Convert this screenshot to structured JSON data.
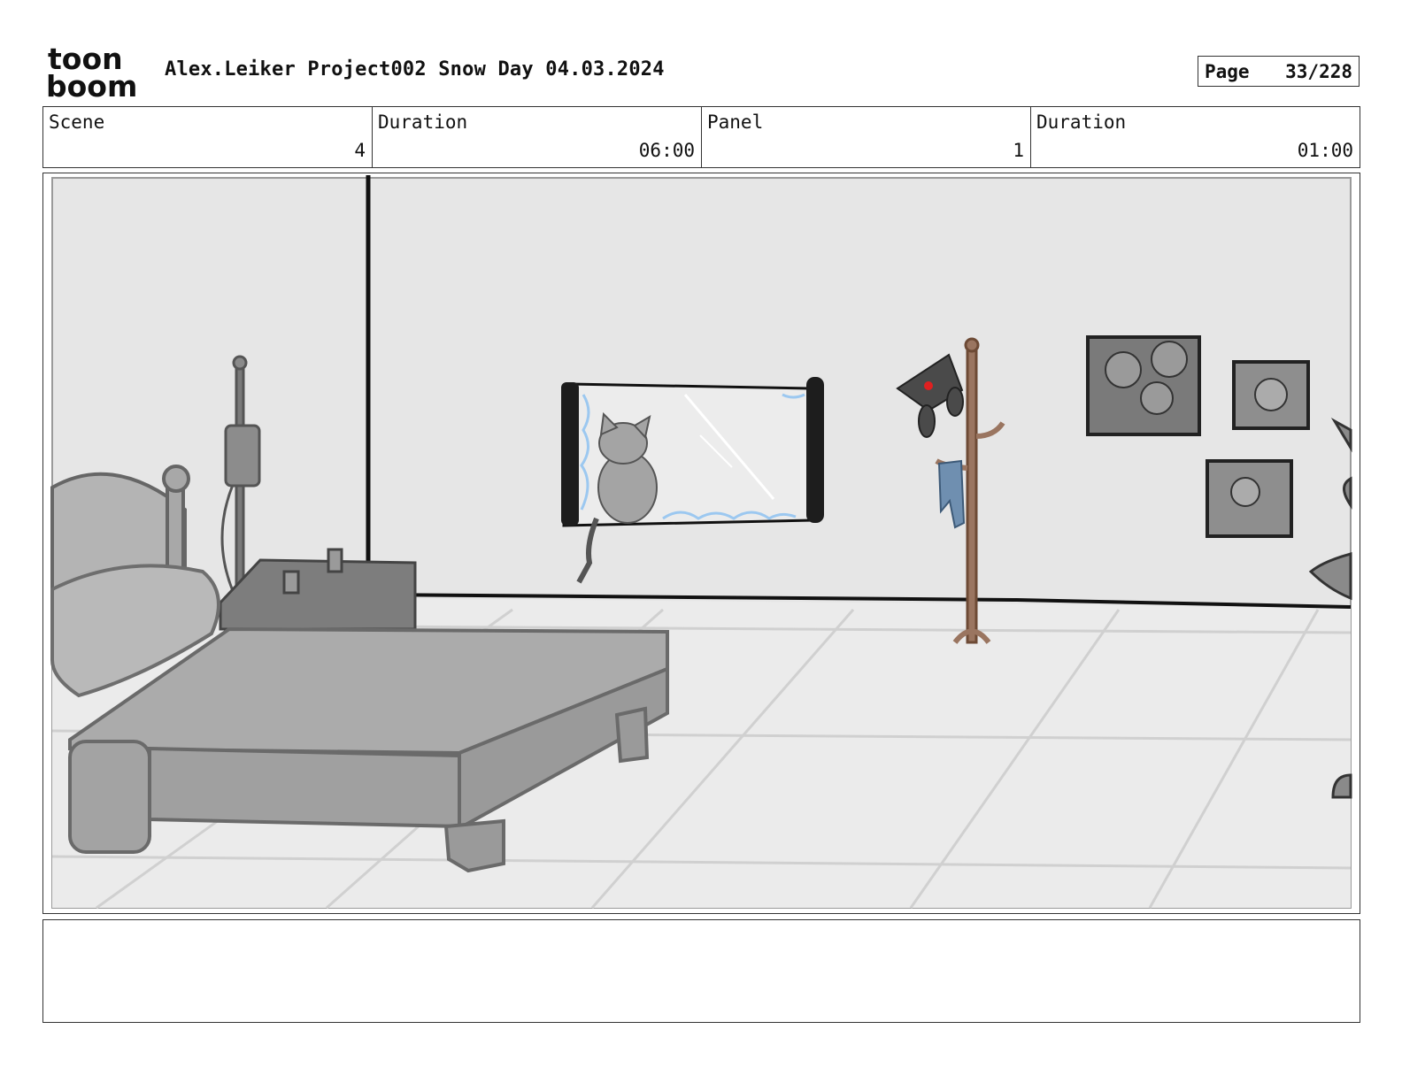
{
  "header": {
    "logo_line1": "toon",
    "logo_line2": "boom",
    "title": "Alex.Leiker Project002 Snow Day 04.03.2024",
    "page_label": "Page",
    "page_value": "33/228"
  },
  "info": [
    {
      "label": "Scene",
      "value": "4"
    },
    {
      "label": "Duration",
      "value": "06:00"
    },
    {
      "label": "Panel",
      "value": "1"
    },
    {
      "label": "Duration",
      "value": "01:00"
    }
  ],
  "notes": "",
  "colors": {
    "wall": "#e6e6e6",
    "floor": "#e9e9e9",
    "line": "#111111",
    "bed": "#a9a9a9",
    "coat_rack": "#9a7560",
    "scarf": "#6f8fb0",
    "frost": "#9cc8f0",
    "hat_star": "#e02020"
  }
}
